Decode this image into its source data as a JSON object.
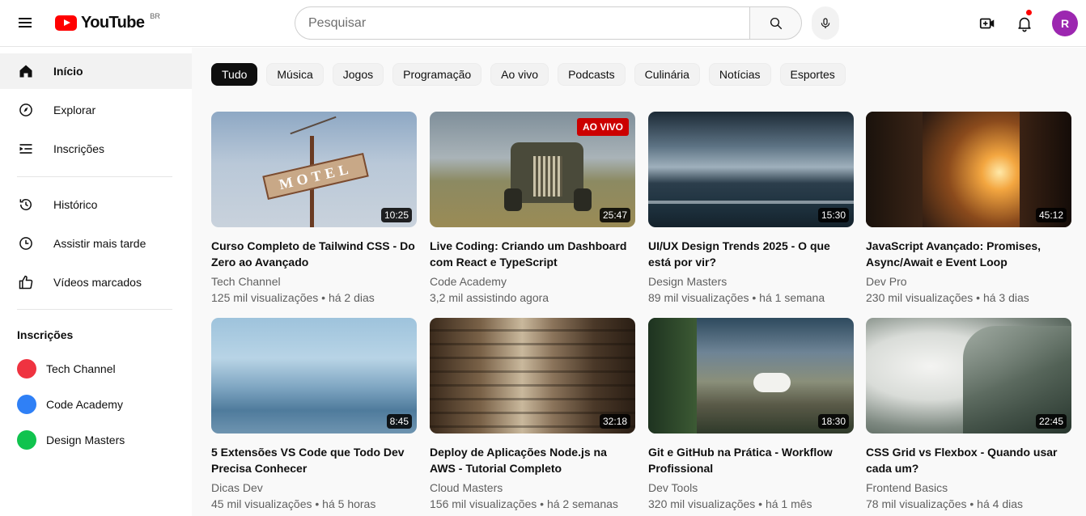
{
  "header": {
    "logo_text": "YouTube",
    "region": "BR",
    "search_placeholder": "Pesquisar",
    "avatar_initial": "R",
    "brand_color": "#ff0000",
    "avatar_color": "#9c27b0"
  },
  "sidebar": {
    "main_items": [
      {
        "label": "Início",
        "icon": "home-icon"
      },
      {
        "label": "Explorar",
        "icon": "compass-icon"
      },
      {
        "label": "Inscrições",
        "icon": "subscriptions-icon"
      }
    ],
    "library_items": [
      {
        "label": "Histórico",
        "icon": "history-icon"
      },
      {
        "label": "Assistir mais tarde",
        "icon": "clock-icon"
      },
      {
        "label": "Vídeos marcados",
        "icon": "thumbs-up-icon"
      }
    ],
    "subscriptions_heading": "Inscrições",
    "subscriptions": [
      {
        "name": "Tech Channel",
        "color": "#ef3340"
      },
      {
        "name": "Code Academy",
        "color": "#2f80f6"
      },
      {
        "name": "Design Masters",
        "color": "#10c34e"
      }
    ]
  },
  "chips": [
    "Tudo",
    "Música",
    "Jogos",
    "Programação",
    "Ao vivo",
    "Podcasts",
    "Culinária",
    "Notícias",
    "Esportes"
  ],
  "videos": [
    {
      "title": "Curso Completo de Tailwind CSS - Do Zero ao Avançado",
      "channel": "Tech Channel",
      "meta": "125 mil visualizações • há 2 dias",
      "duration": "10:25",
      "live": ""
    },
    {
      "title": "Live Coding: Criando um Dashboard com React e TypeScript",
      "channel": "Code Academy",
      "meta": "3,2 mil assistindo agora",
      "duration": "25:47",
      "live": "AO VIVO"
    },
    {
      "title": "UI/UX Design Trends 2025 - O que está por vir?",
      "channel": "Design Masters",
      "meta": "89 mil visualizações • há 1 semana",
      "duration": "15:30",
      "live": ""
    },
    {
      "title": "JavaScript Avançado: Promises, Async/Await e Event Loop",
      "channel": "Dev Pro",
      "meta": "230 mil visualizações • há 3 dias",
      "duration": "45:12",
      "live": ""
    },
    {
      "title": "5 Extensões VS Code que Todo Dev Precisa Conhecer",
      "channel": "Dicas Dev",
      "meta": "45 mil visualizações • há 5 horas",
      "duration": "8:45",
      "live": ""
    },
    {
      "title": "Deploy de Aplicações Node.js na AWS - Tutorial Completo",
      "channel": "Cloud Masters",
      "meta": "156 mil visualizações • há 2 semanas",
      "duration": "32:18",
      "live": ""
    },
    {
      "title": "Git e GitHub na Prática - Workflow Profissional",
      "channel": "Dev Tools",
      "meta": "320 mil visualizações • há 1 mês",
      "duration": "18:30",
      "live": ""
    },
    {
      "title": "CSS Grid vs Flexbox - Quando usar cada um?",
      "channel": "Frontend Basics",
      "meta": "78 mil visualizações • há 4 dias",
      "duration": "22:45",
      "live": ""
    }
  ]
}
